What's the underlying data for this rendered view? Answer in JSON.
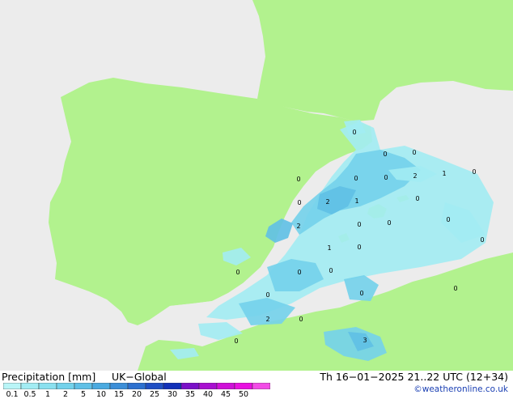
{
  "header": {
    "title": "Precipitation [mm]",
    "model": "UK−Global",
    "datetime": "Th 16−01−2025 21..22 UTC (12+34)",
    "credit": "©weatheronline.co.uk"
  },
  "legend": {
    "ticks": [
      "0.1",
      "0.5",
      "1",
      "2",
      "5",
      "10",
      "15",
      "20",
      "25",
      "30",
      "35",
      "40",
      "45",
      "50"
    ],
    "colors": [
      "#b9f5f7",
      "#a2ecf3",
      "#8ae0ef",
      "#73d2eb",
      "#5fc0e6",
      "#4aaae0",
      "#3b8ed8",
      "#2d70cf",
      "#1f4fc4",
      "#1130b8",
      "#7a10c8",
      "#a810d0",
      "#cf10d8",
      "#e810e0",
      "#f24ce6"
    ]
  },
  "map": {
    "land_color": "#b2f28e",
    "sea_color": "#ececec",
    "value_labels": [
      "0",
      "0",
      "0",
      "0",
      "2",
      "1",
      "0",
      "0",
      "2",
      "1",
      "0",
      "0",
      "0",
      "0",
      "2",
      "1",
      "0",
      "0",
      "0",
      "0",
      "0",
      "0",
      "0",
      "0",
      "0",
      "2",
      "0",
      "0",
      "3",
      "0"
    ]
  }
}
